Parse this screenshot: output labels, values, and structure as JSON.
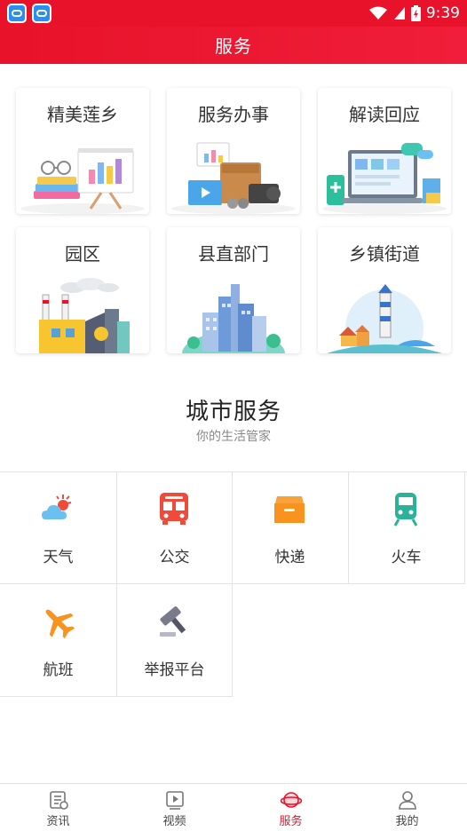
{
  "status_bar": {
    "time": "9:39"
  },
  "header": {
    "title": "服务"
  },
  "cards": [
    {
      "title": "精美莲乡"
    },
    {
      "title": "服务办事"
    },
    {
      "title": "解读回应"
    },
    {
      "title": "园区"
    },
    {
      "title": "县直部门"
    },
    {
      "title": "乡镇街道"
    }
  ],
  "city_service": {
    "title": "城市服务",
    "subtitle": "你的生活管家",
    "items": [
      {
        "label": "天气",
        "icon": "weather-icon"
      },
      {
        "label": "公交",
        "icon": "bus-icon"
      },
      {
        "label": "快递",
        "icon": "express-box-icon"
      },
      {
        "label": "火车",
        "icon": "train-icon"
      },
      {
        "label": "航班",
        "icon": "airplane-icon"
      },
      {
        "label": "举报平台",
        "icon": "gavel-icon"
      }
    ]
  },
  "tabbar": {
    "tabs": [
      {
        "label": "资讯",
        "icon": "news-icon"
      },
      {
        "label": "视频",
        "icon": "video-icon"
      },
      {
        "label": "服务",
        "icon": "planet-icon",
        "active": true
      },
      {
        "label": "我的",
        "icon": "person-icon"
      }
    ]
  },
  "colors": {
    "brand_red": "#e8122a",
    "bus_red": "#f04a3a",
    "express_orange": "#f7931e",
    "train_teal": "#2bb39a"
  }
}
